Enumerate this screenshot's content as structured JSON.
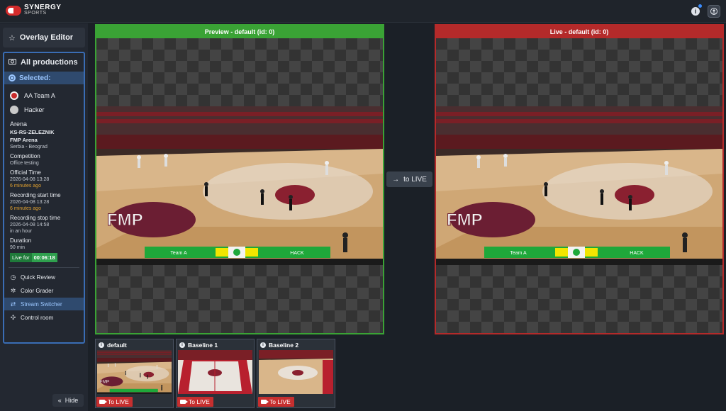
{
  "brand": {
    "name": "SYNERGY",
    "sub": "SPORTS"
  },
  "topbar": {
    "info_icon": "info-icon",
    "user_icon": "user-icon"
  },
  "sidebar": {
    "overlay_editor": "Overlay Editor",
    "all_productions": "All productions",
    "selected_label": "Selected:",
    "teams": [
      "AA Team A",
      "Hacker"
    ],
    "arena_label": "Arena",
    "arena_code": "KS-RS-ZELEZNIK",
    "arena_name": "FMP Arena",
    "arena_location": "Serbia - Beograd",
    "competition_label": "Competition",
    "competition_value": "Office testing",
    "official_time_label": "Official Time",
    "official_time_value": "2026-04-08 13:28",
    "official_time_rel": "6 minutes ago",
    "rec_start_label": "Recording start time",
    "rec_start_value": "2026-04-08 13:28",
    "rec_start_rel": "6 minutes ago",
    "rec_stop_label": "Recording stop time",
    "rec_stop_value": "2026-04-08 14:58",
    "rec_stop_rel": "in an hour",
    "duration_label": "Duration",
    "duration_value": "90 min",
    "live_for_label": "Live for",
    "live_for_value": "00:06:18",
    "menu": [
      {
        "label": "Quick Review",
        "icon": "clock-icon"
      },
      {
        "label": "Color Grader",
        "icon": "gear-icon"
      },
      {
        "label": "Stream Switcher",
        "icon": "switch-icon"
      },
      {
        "label": "Control room",
        "icon": "network-icon"
      }
    ],
    "hide_label": "Hide"
  },
  "preview": {
    "title": "Preview - default (id: 0)"
  },
  "live": {
    "title": "Live - default (id: 0)"
  },
  "to_live_button": "to LIVE",
  "scoreboard": {
    "team_left": "Team A",
    "team_right": "HACK"
  },
  "sources": [
    {
      "name": "default",
      "button": "To LIVE"
    },
    {
      "name": "Baseline 1",
      "button": "To LIVE"
    },
    {
      "name": "Baseline 2",
      "button": "To LIVE"
    }
  ],
  "colors": {
    "preview": "#3aa335",
    "live": "#b42a2a",
    "accent": "#3a6db5",
    "button_red": "#c62f2f"
  }
}
